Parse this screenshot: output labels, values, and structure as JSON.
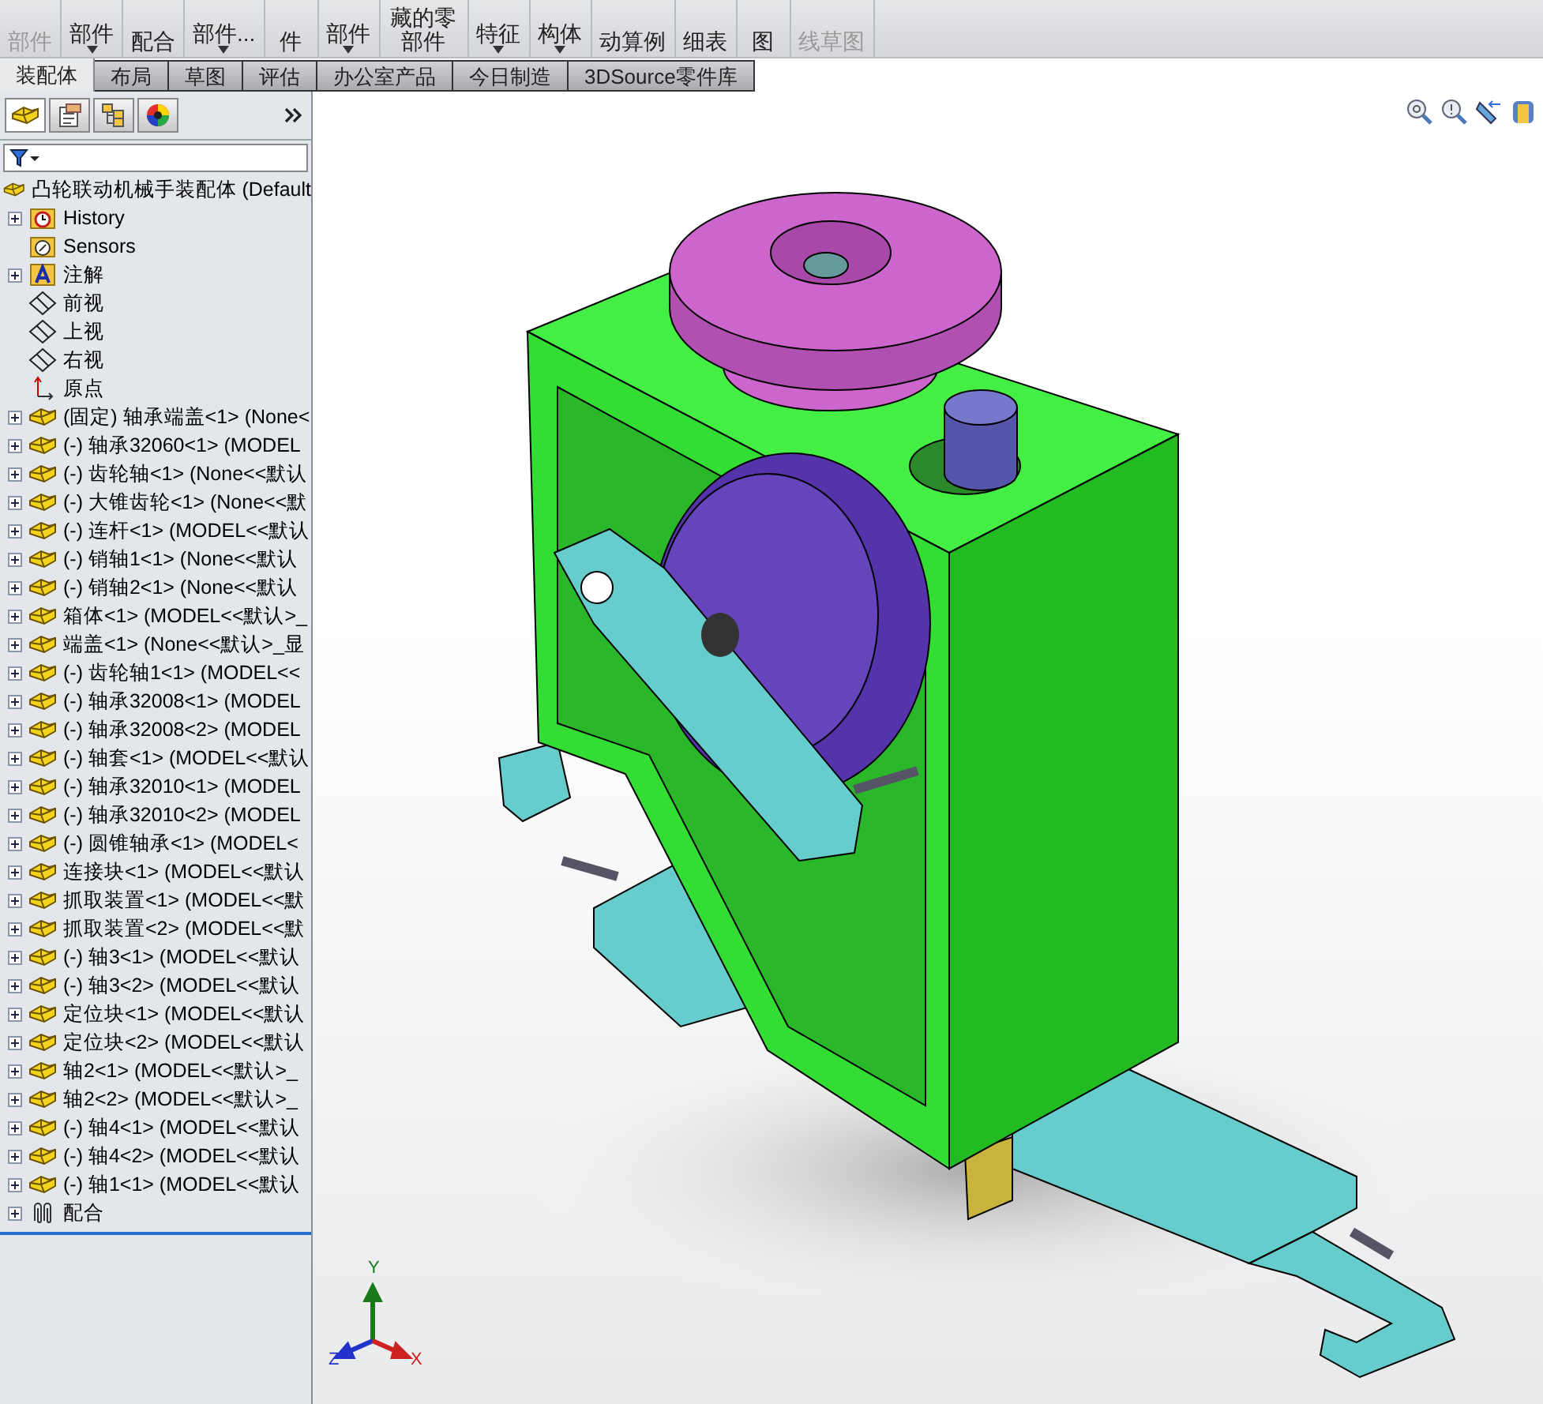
{
  "toolbar": {
    "buttons": [
      {
        "label": "部件",
        "disabled": true,
        "dropdown": false
      },
      {
        "label": "部件",
        "disabled": false,
        "dropdown": true
      },
      {
        "label": "配合",
        "disabled": false,
        "dropdown": false
      },
      {
        "label": "部件...",
        "disabled": false,
        "dropdown": true
      },
      {
        "label": "件",
        "disabled": false,
        "dropdown": false
      },
      {
        "label": "部件",
        "disabled": false,
        "dropdown": true
      },
      {
        "label": "藏的零部件",
        "disabled": false,
        "dropdown": false
      },
      {
        "label": "特征",
        "disabled": false,
        "dropdown": true
      },
      {
        "label": "构体",
        "disabled": false,
        "dropdown": true
      },
      {
        "label": "动算例",
        "disabled": false,
        "dropdown": false
      },
      {
        "label": "细表",
        "disabled": false,
        "dropdown": false
      },
      {
        "label": "图",
        "disabled": false,
        "dropdown": false
      },
      {
        "label": "线草图",
        "disabled": true,
        "dropdown": false
      }
    ]
  },
  "tabs": [
    {
      "label": "装配体",
      "selected": true
    },
    {
      "label": "布局",
      "selected": false
    },
    {
      "label": "草图",
      "selected": false
    },
    {
      "label": "评估",
      "selected": false
    },
    {
      "label": "办公室产品",
      "selected": false
    },
    {
      "label": "今日制造",
      "selected": false
    },
    {
      "label": "3DSource零件库",
      "selected": false
    }
  ],
  "tree": {
    "root": "凸轮联动机械手装配体  (Default",
    "items": [
      {
        "kind": "history",
        "label": "History",
        "expandable": true
      },
      {
        "kind": "sensors",
        "label": "Sensors",
        "expandable": false
      },
      {
        "kind": "annotations",
        "label": "注解",
        "expandable": true
      },
      {
        "kind": "plane",
        "label": "前视",
        "expandable": false
      },
      {
        "kind": "plane",
        "label": "上视",
        "expandable": false
      },
      {
        "kind": "plane",
        "label": "右视",
        "expandable": false
      },
      {
        "kind": "origin",
        "label": "原点",
        "expandable": false
      },
      {
        "kind": "part",
        "label": "(固定) 轴承端盖<1> (None<",
        "expandable": true
      },
      {
        "kind": "part",
        "label": "(-) 轴承32060<1> (MODEL",
        "expandable": true
      },
      {
        "kind": "part",
        "label": "(-) 齿轮轴<1> (None<<默认",
        "expandable": true
      },
      {
        "kind": "part",
        "label": "(-) 大锥齿轮<1> (None<<默",
        "expandable": true
      },
      {
        "kind": "part",
        "label": "(-) 连杆<1> (MODEL<<默认",
        "expandable": true
      },
      {
        "kind": "part",
        "label": "(-) 销轴1<1> (None<<默认",
        "expandable": true
      },
      {
        "kind": "part",
        "label": "(-) 销轴2<1> (None<<默认",
        "expandable": true
      },
      {
        "kind": "part",
        "label": "箱体<1> (MODEL<<默认>_",
        "expandable": true
      },
      {
        "kind": "part",
        "label": "端盖<1> (None<<默认>_显",
        "expandable": true
      },
      {
        "kind": "part",
        "label": "(-) 齿轮轴1<1> (MODEL<<",
        "expandable": true
      },
      {
        "kind": "part",
        "label": "(-) 轴承32008<1> (MODEL",
        "expandable": true
      },
      {
        "kind": "part",
        "label": "(-) 轴承32008<2> (MODEL",
        "expandable": true
      },
      {
        "kind": "part",
        "label": "(-) 轴套<1> (MODEL<<默认",
        "expandable": true
      },
      {
        "kind": "part",
        "label": "(-) 轴承32010<1> (MODEL",
        "expandable": true
      },
      {
        "kind": "part",
        "label": "(-) 轴承32010<2> (MODEL",
        "expandable": true
      },
      {
        "kind": "part",
        "label": "(-) 圆锥轴承<1> (MODEL<",
        "expandable": true
      },
      {
        "kind": "part",
        "label": "连接块<1> (MODEL<<默认",
        "expandable": true
      },
      {
        "kind": "part",
        "label": "抓取装置<1> (MODEL<<默",
        "expandable": true
      },
      {
        "kind": "part",
        "label": "抓取装置<2> (MODEL<<默",
        "expandable": true
      },
      {
        "kind": "part",
        "label": "(-) 轴3<1> (MODEL<<默认",
        "expandable": true
      },
      {
        "kind": "part",
        "label": "(-) 轴3<2> (MODEL<<默认",
        "expandable": true
      },
      {
        "kind": "part",
        "label": "定位块<1> (MODEL<<默认",
        "expandable": true
      },
      {
        "kind": "part",
        "label": "定位块<2> (MODEL<<默认",
        "expandable": true
      },
      {
        "kind": "part",
        "label": "轴2<1> (MODEL<<默认>_",
        "expandable": true
      },
      {
        "kind": "part",
        "label": "轴2<2> (MODEL<<默认>_",
        "expandable": true
      },
      {
        "kind": "part",
        "label": "(-) 轴4<1> (MODEL<<默认",
        "expandable": true
      },
      {
        "kind": "part",
        "label": "(-) 轴4<2> (MODEL<<默认",
        "expandable": true
      },
      {
        "kind": "part",
        "label": "(-) 轴1<1> (MODEL<<默认",
        "expandable": true
      },
      {
        "kind": "mates",
        "label": "配合",
        "expandable": true
      }
    ]
  },
  "triad": {
    "x": "X",
    "y": "Y",
    "z": "Z"
  }
}
